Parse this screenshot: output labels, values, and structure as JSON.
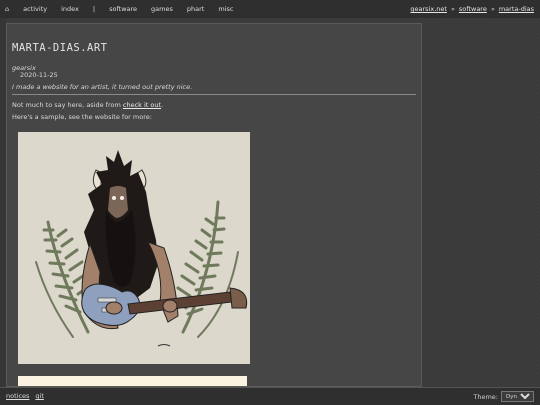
{
  "nav": {
    "home_glyph": "⌂",
    "items": [
      "activity",
      "index",
      "|",
      "software",
      "games",
      "phart",
      "misc"
    ]
  },
  "breadcrumb": {
    "items": [
      "gearsix.net",
      "software",
      "marta-dias"
    ],
    "separator": "»"
  },
  "post": {
    "title": "MARTA-DIAS.ART",
    "author": "gearsix",
    "date": "2020-11-25",
    "tagline": "I made a website for an artist, it turned out pretty nice.",
    "p1_before": "Not much to say here, aside from ",
    "p1_link": "check it out",
    "p1_after": ".",
    "p2": "Here's a sample, see the website for more:"
  },
  "footer": {
    "links": [
      "notices",
      "git"
    ],
    "theme_label": "Theme:",
    "theme_value": "Dyno"
  },
  "colors": {
    "background": "#3b3b3b",
    "content_panel": "#464646",
    "artwork_bg": "#dcd8cb",
    "guitar": "#8ea0bd"
  }
}
